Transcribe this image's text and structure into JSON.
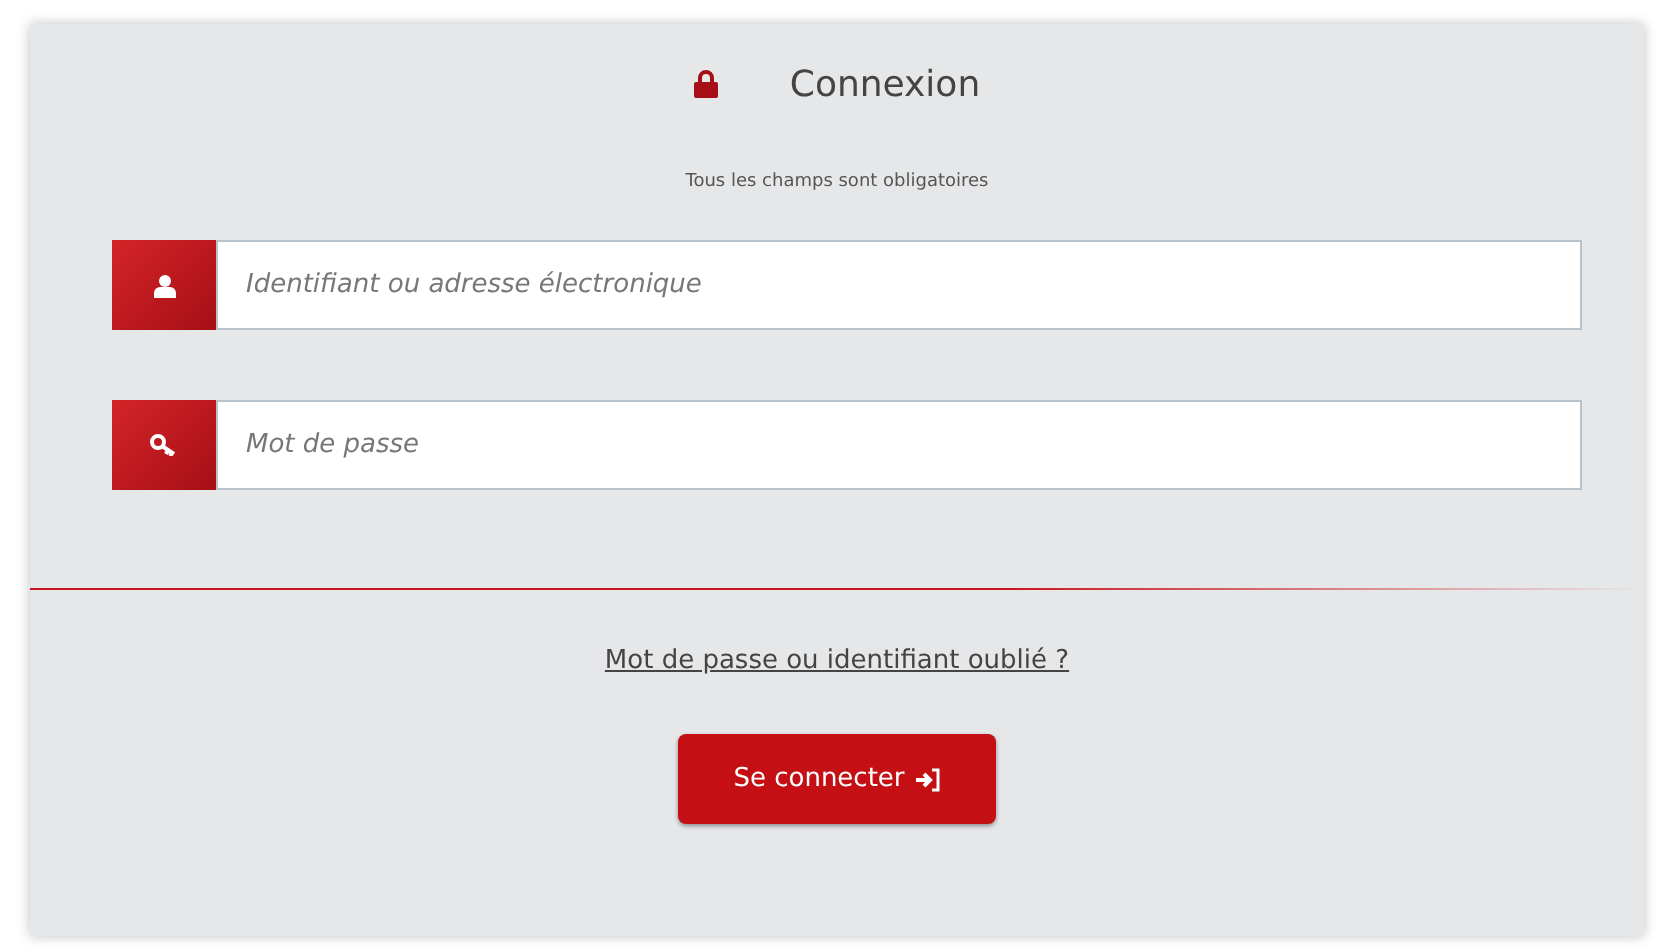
{
  "title": "Connexion",
  "note": "Tous les champs sont obligatoires",
  "fields": [
    {
      "placeholder": "Identifiant ou adresse électronique"
    },
    {
      "placeholder": "Mot de passe"
    }
  ],
  "forgot_link": "Mot de passe ou identifiant oublié ?",
  "submit_button": "Se connecter"
}
